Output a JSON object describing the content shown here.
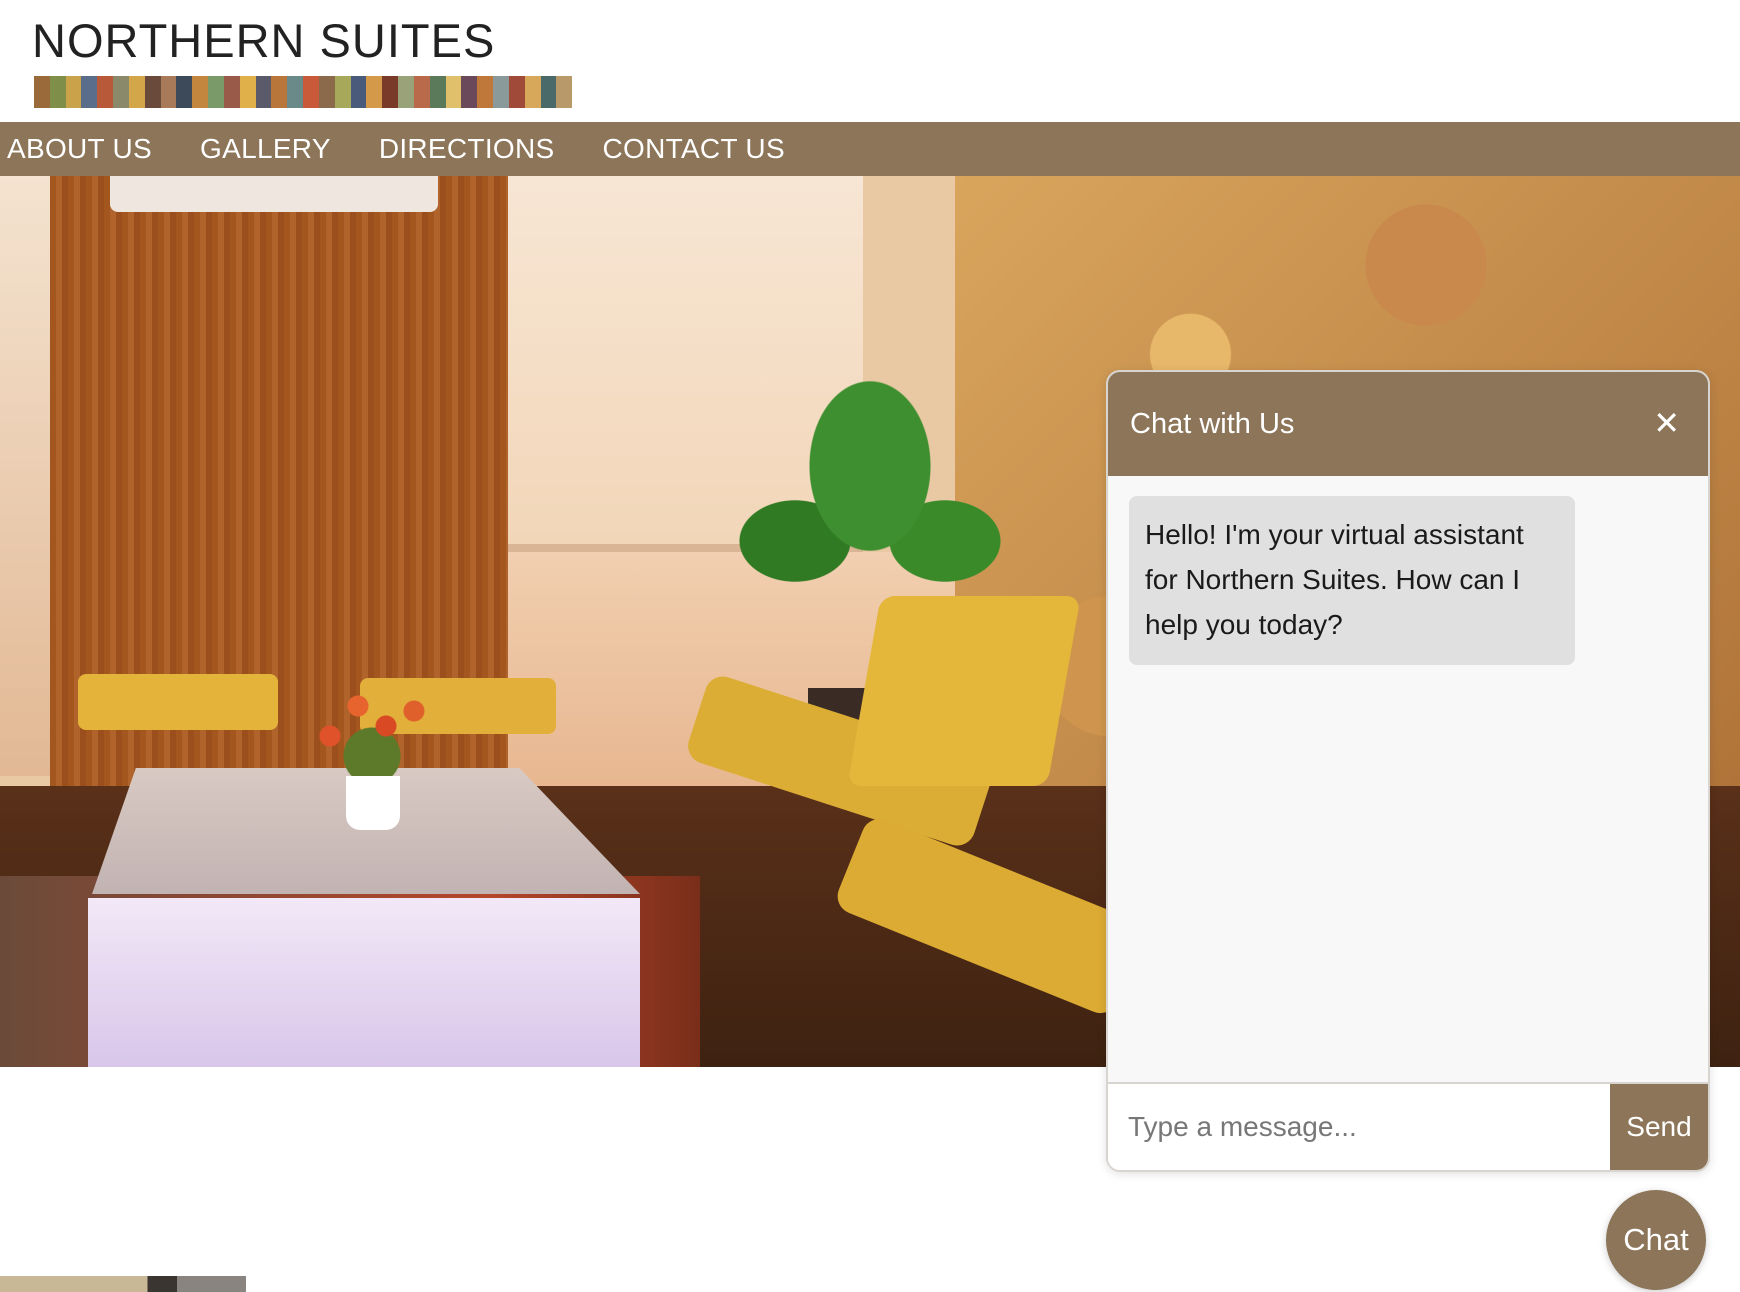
{
  "brand": {
    "logo_text": "NORTHERN SUITES",
    "stripe_colors": [
      "#9b6a3a",
      "#7f8f4a",
      "#c9a24a",
      "#5a6d8a",
      "#b85a3a",
      "#8a8a6a",
      "#d4a64a",
      "#6a4a3a",
      "#a87a5a",
      "#3d4a5a",
      "#c2863e",
      "#7a9a6a",
      "#9a5a4a",
      "#e0b04a",
      "#5a5a6a",
      "#b8763a",
      "#6a8a8a",
      "#c85a3a",
      "#8a6a4a",
      "#a8a85a",
      "#4a5a7a",
      "#d49a4a",
      "#7a3a2a",
      "#9aa27a",
      "#b86a4a",
      "#5a7a5a",
      "#e0c06a",
      "#6a4a5a",
      "#c0783a",
      "#8a9a9a",
      "#a04a3a",
      "#d8a85a",
      "#4a6a6a",
      "#b89a6a"
    ]
  },
  "nav": {
    "items": [
      "ABOUT US",
      "GALLERY",
      "DIRECTIONS",
      "CONTACT US"
    ]
  },
  "chat": {
    "title": "Chat with Us",
    "close_icon": "close-icon",
    "close_glyph": "✕",
    "messages": [
      {
        "from": "assistant",
        "text": "Hello! I'm your virtual assistant for Northern Suites. How can I help you today?"
      }
    ],
    "input_placeholder": "Type a message...",
    "send_label": "Send",
    "launcher_label": "Chat"
  },
  "colors": {
    "accent": "#8c7558",
    "bubble": "#e0e0e0",
    "panel": "#f8f8f8"
  }
}
